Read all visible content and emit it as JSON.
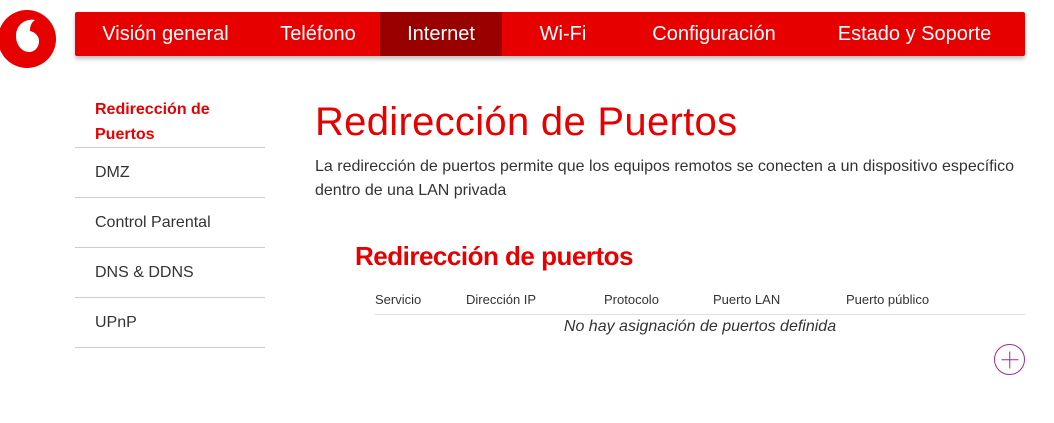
{
  "brand": {
    "accent": "#e60000",
    "active_tab": "#990000",
    "add_icon": "#9c2aa0"
  },
  "nav": {
    "items": [
      {
        "label": "Visión general"
      },
      {
        "label": "Teléfono"
      },
      {
        "label": "Internet",
        "active": true
      },
      {
        "label": "Wi-Fi"
      },
      {
        "label": "Configuración"
      },
      {
        "label": "Estado y Soporte"
      }
    ]
  },
  "sidebar": {
    "items": [
      {
        "label": "Redirección de Puertos",
        "active": true
      },
      {
        "label": "DMZ"
      },
      {
        "label": "Control Parental"
      },
      {
        "label": "DNS & DDNS"
      },
      {
        "label": "UPnP"
      }
    ]
  },
  "main": {
    "title": "Redirección de Puertos",
    "description": "La redirección de puertos permite que los equipos remotos se conecten a un dispositivo específico dentro de una LAN privada",
    "section_title": "Redirección de puertos",
    "table": {
      "columns": [
        "Servicio",
        "Dirección IP",
        "Protocolo",
        "Puerto LAN",
        "Puerto público"
      ],
      "empty_message": "No hay asignación de puertos definida"
    },
    "add_icon": "plus-circle-icon"
  }
}
